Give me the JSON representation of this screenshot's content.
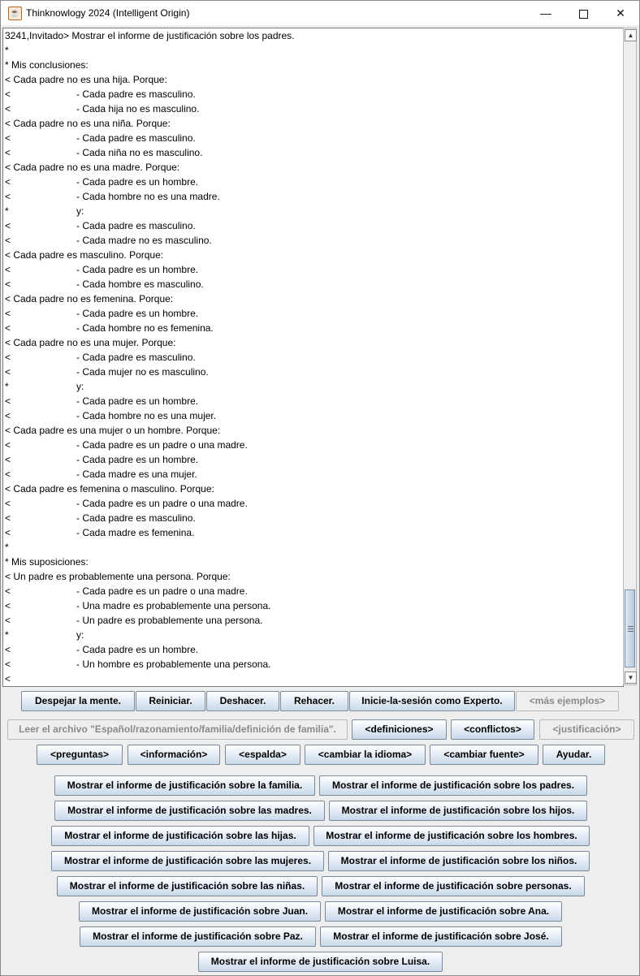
{
  "window": {
    "title": "Thinknowlogy 2024 (Intelligent Origin)",
    "minimize": "—",
    "close": "✕"
  },
  "log": {
    "lines": [
      {
        "text": "3241,Invitado> Mostrar el informe de justificación sobre los padres."
      },
      {
        "text": "*"
      },
      {
        "text": "* Mis conclusiones:"
      },
      {
        "text": "< Cada padre no es una hija. Porque:"
      },
      {
        "prefix": "<",
        "text": "- Cada padre es masculino."
      },
      {
        "prefix": "<",
        "text": "- Cada hija no es masculino."
      },
      {
        "text": "< Cada padre no es una niña. Porque:"
      },
      {
        "prefix": "<",
        "text": "- Cada padre es masculino."
      },
      {
        "prefix": "<",
        "text": "- Cada niña no es masculino."
      },
      {
        "text": "< Cada padre no es una madre. Porque:"
      },
      {
        "prefix": "<",
        "text": "- Cada padre es un hombre."
      },
      {
        "prefix": "<",
        "text": "- Cada hombre no es una madre."
      },
      {
        "prefix": "*",
        "text": "y:"
      },
      {
        "prefix": "<",
        "text": "- Cada padre es masculino."
      },
      {
        "prefix": "<",
        "text": "- Cada madre no es masculino."
      },
      {
        "text": "< Cada padre es masculino. Porque:"
      },
      {
        "prefix": "<",
        "text": "- Cada padre es un hombre."
      },
      {
        "prefix": "<",
        "text": "- Cada hombre es masculino."
      },
      {
        "text": "< Cada padre no es femenina. Porque:"
      },
      {
        "prefix": "<",
        "text": "- Cada padre es un hombre."
      },
      {
        "prefix": "<",
        "text": "- Cada hombre no es femenina."
      },
      {
        "text": "< Cada padre no es una mujer. Porque:"
      },
      {
        "prefix": "<",
        "text": "- Cada padre es masculino."
      },
      {
        "prefix": "<",
        "text": "- Cada mujer no es masculino."
      },
      {
        "prefix": "*",
        "text": "y:"
      },
      {
        "prefix": "<",
        "text": "- Cada padre es un hombre."
      },
      {
        "prefix": "<",
        "text": "- Cada hombre no es una mujer."
      },
      {
        "text": "< Cada padre es una mujer o un hombre. Porque:"
      },
      {
        "prefix": "<",
        "text": "- Cada padre es un padre o una madre."
      },
      {
        "prefix": "<",
        "text": "- Cada padre es un hombre."
      },
      {
        "prefix": "<",
        "text": "- Cada madre es una mujer."
      },
      {
        "text": "< Cada padre es femenina o masculino. Porque:"
      },
      {
        "prefix": "<",
        "text": "- Cada padre es un padre o una madre."
      },
      {
        "prefix": "<",
        "text": "- Cada padre es masculino."
      },
      {
        "prefix": "<",
        "text": "- Cada madre es femenina."
      },
      {
        "text": "*"
      },
      {
        "text": "* Mis suposiciones:"
      },
      {
        "text": "< Un padre es probablemente una persona. Porque:"
      },
      {
        "prefix": "<",
        "text": "- Cada padre es un padre o una madre."
      },
      {
        "prefix": "<",
        "text": "- Una madre es probablemente una persona."
      },
      {
        "prefix": "<",
        "text": "- Un padre es probablemente una persona."
      },
      {
        "prefix": "*",
        "text": "y:"
      },
      {
        "prefix": "<",
        "text": "- Cada padre es un hombre."
      },
      {
        "prefix": "<",
        "text": "- Un hombre es probablemente una persona."
      },
      {
        "text": "<"
      }
    ]
  },
  "scrollbar": {
    "position": 0.92,
    "up_arrow": "▲",
    "down_arrow": "▼"
  },
  "buttons": {
    "row1": [
      {
        "label": "Despejar la mente.",
        "enabled": true
      },
      {
        "label": "Reiniciar.",
        "enabled": true
      },
      {
        "label": "Deshacer.",
        "enabled": true
      },
      {
        "label": "Rehacer.",
        "enabled": true
      },
      {
        "label": "Inicie-la-sesión como Experto.",
        "enabled": true
      },
      {
        "label": "<más ejemplos>",
        "enabled": false
      }
    ],
    "row2": [
      {
        "label": "Leer el archivo \"Español/razonamiento/familia/definición de familia\".",
        "enabled": false
      },
      {
        "label": "<definiciones>",
        "enabled": true
      },
      {
        "label": "<conflictos>",
        "enabled": true
      },
      {
        "label": "<justificación>",
        "enabled": false
      }
    ],
    "row3": [
      {
        "label": "<preguntas>",
        "enabled": true
      },
      {
        "label": "<información>",
        "enabled": true
      },
      {
        "label": "<espalda>",
        "enabled": true
      },
      {
        "label": "<cambiar la idioma>",
        "enabled": true
      },
      {
        "label": "<cambiar fuente>",
        "enabled": true
      },
      {
        "label": "Ayudar.",
        "enabled": true
      }
    ],
    "reports": [
      "Mostrar el informe de justificación sobre la familia.",
      "Mostrar el informe de justificación sobre los padres.",
      "Mostrar el informe de justificación sobre las madres.",
      "Mostrar el informe de justificación sobre los hijos.",
      "Mostrar el informe de justificación sobre las hijas.",
      "Mostrar el informe de justificación sobre los hombres.",
      "Mostrar el informe de justificación sobre las mujeres.",
      "Mostrar el informe de justificación sobre los niños.",
      "Mostrar el informe de justificación sobre las niñas.",
      "Mostrar el informe de justificación sobre personas.",
      "Mostrar el informe de justificación sobre Juan.",
      "Mostrar el informe de justificación sobre Ana.",
      "Mostrar el informe de justificación sobre Paz.",
      "Mostrar el informe de justificación sobre José.",
      "Mostrar el informe de justificación sobre Luisa."
    ]
  }
}
